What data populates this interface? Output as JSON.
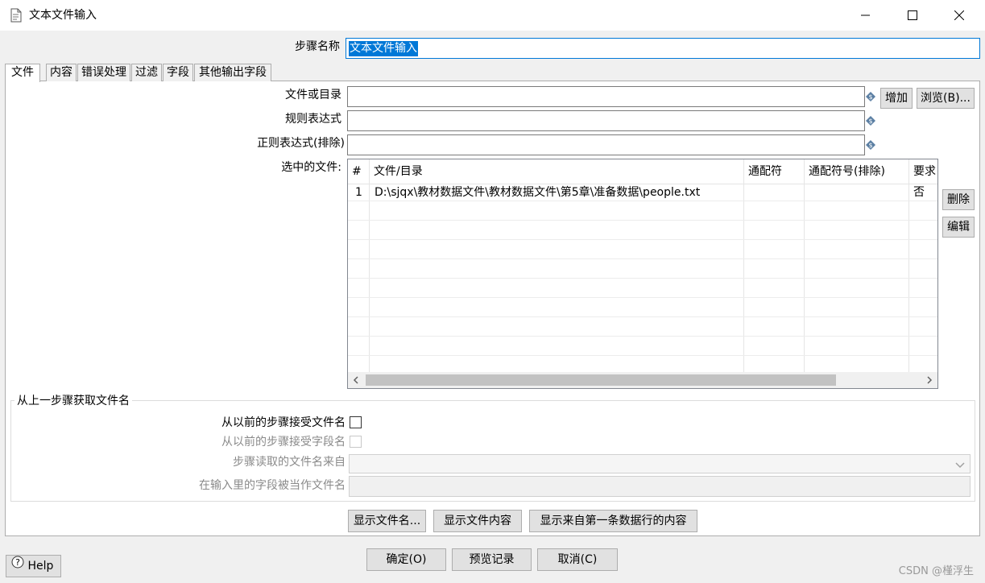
{
  "window": {
    "title": "文本文件输入",
    "controls": {
      "minimize_icon": "minimize-icon",
      "maximize_icon": "maximize-icon",
      "close_icon": "close-icon"
    }
  },
  "step_name": {
    "label": "步骤名称",
    "value": "文本文件输入"
  },
  "tabs": [
    "文件",
    "内容",
    "错误处理",
    "过滤",
    "字段",
    "其他输出字段"
  ],
  "active_tab": "文件",
  "file_tab": {
    "file_or_dir_label": "文件或目录",
    "regex_label": "规则表达式",
    "regex_exclude_label": "正则表达式(排除)",
    "selected_files_label": "选中的文件:",
    "add_button": "增加",
    "browse_button": "浏览(B)...",
    "delete_button": "删除",
    "edit_button": "编辑",
    "table": {
      "columns": [
        "#",
        "文件/目录",
        "通配符",
        "通配符号(排除)",
        "要求"
      ],
      "rows": [
        {
          "num": "1",
          "path": "D:\\sjqx\\教材数据文件\\教材数据文件\\第5章\\准备数据\\people.txt",
          "wildcard": "",
          "wildcard_exclude": "",
          "required": "否"
        }
      ]
    }
  },
  "prev_step_group": {
    "title": "从上一步骤获取文件名",
    "accept_filenames_label": "从以前的步骤接受文件名",
    "accept_fields_label": "从以前的步骤接受字段名",
    "step_read_from_label": "步骤读取的文件名来自",
    "field_as_filename_label": "在输入里的字段被当作文件名",
    "accept_filenames_checked": false,
    "accept_fields_checked": false
  },
  "preview_buttons": {
    "show_filenames": "显示文件名...",
    "show_content": "显示文件内容",
    "show_first_row": "显示来自第一条数据行的内容"
  },
  "footer": {
    "help": "Help",
    "ok": "确定(O)",
    "preview": "预览记录",
    "cancel": "取消(C)"
  },
  "watermark": "CSDN @槿浮生"
}
